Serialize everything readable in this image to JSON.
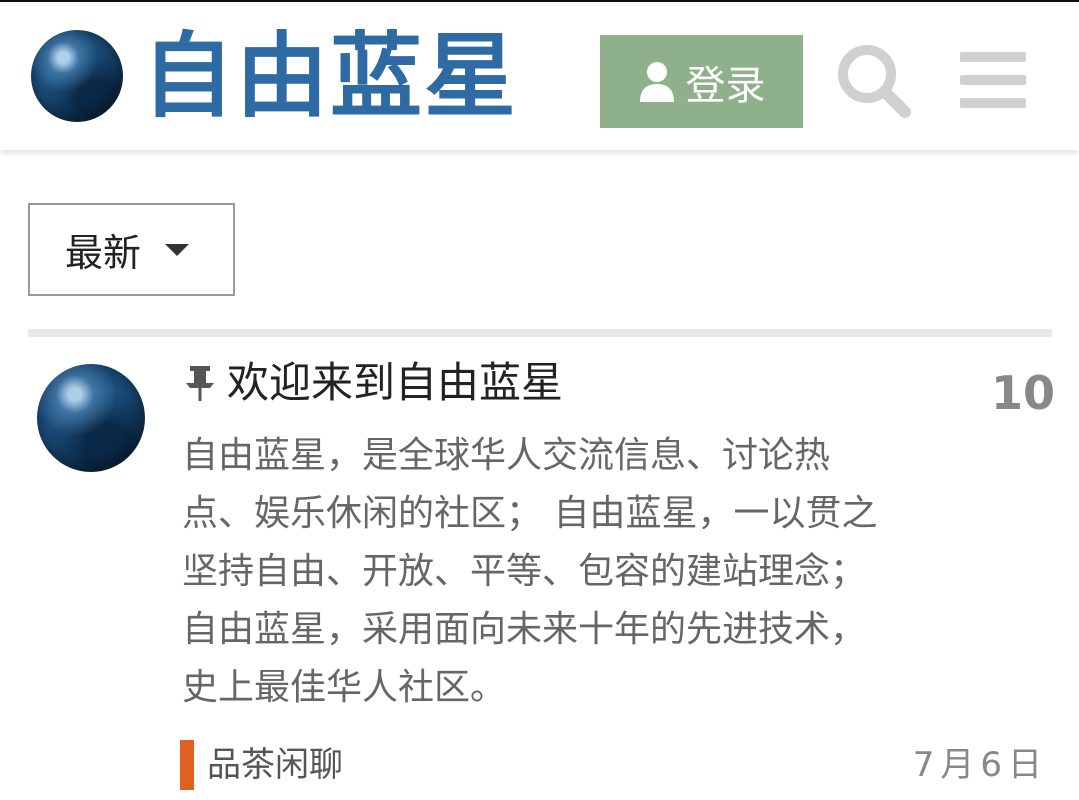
{
  "header": {
    "site_title": "自由蓝星",
    "login_label": "登录",
    "colors": {
      "brand": "#2e6aa3",
      "login_bg": "#8eb18b"
    },
    "icons": [
      "globe-logo-icon",
      "user-icon",
      "search-icon",
      "hamburger-menu-icon"
    ]
  },
  "filter": {
    "label": "最新"
  },
  "topic": {
    "title": "欢迎来到自由蓝星",
    "reply_count": "10",
    "excerpt_lines": [
      "自由蓝星，是全球华人交流信息、讨论热",
      "点、娱乐休闲的社区； 自由蓝星，一以贯之",
      "坚持自由、开放、平等、包容的建站理念；",
      "自由蓝星，采用面向未来十年的先进技术，",
      "史上最佳华人社区。"
    ],
    "category": {
      "name": "品茶闲聊",
      "color": "#e06020"
    },
    "date": "7月6日",
    "pinned": true
  }
}
